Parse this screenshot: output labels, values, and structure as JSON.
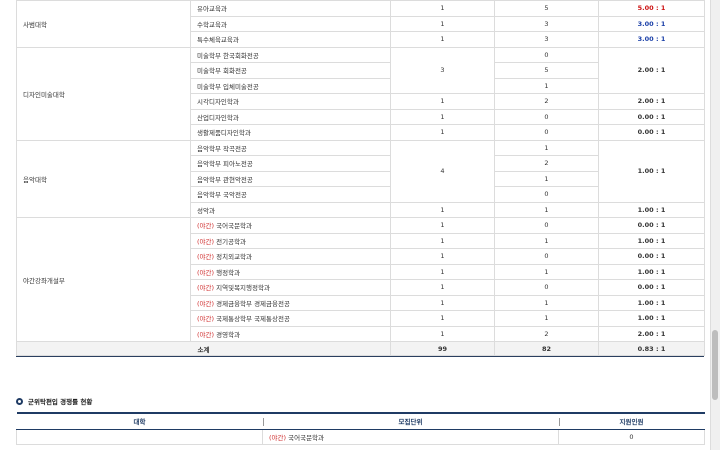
{
  "table1": {
    "groups": [
      {
        "college": "사범대학",
        "rows": [
          {
            "unit": "유아교육과",
            "quota": "1",
            "applicants": "5",
            "ratio": "5.00 : 1",
            "ratio_color": "red"
          },
          {
            "unit": "수학교육과",
            "quota": "1",
            "applicants": "3",
            "ratio": "3.00 : 1",
            "ratio_color": "blue"
          },
          {
            "unit": "특수체육교육과",
            "quota": "1",
            "applicants": "3",
            "ratio": "3.00 : 1",
            "ratio_color": "blue"
          }
        ]
      },
      {
        "college": "디자인미술대학",
        "rows": [
          {
            "unit": "미술학부 한국회화전공",
            "quota": "3",
            "applicants": "0",
            "ratio": "2.00 : 1",
            "merged_quota": 3
          },
          {
            "unit": "미술학부 회화전공",
            "applicants": "5"
          },
          {
            "unit": "미술학부 입체미술전공",
            "applicants": "1"
          },
          {
            "unit": "시각디자인학과",
            "quota": "1",
            "applicants": "2",
            "ratio": "2.00 : 1"
          },
          {
            "unit": "산업디자인학과",
            "quota": "1",
            "applicants": "0",
            "ratio": "0.00 : 1"
          },
          {
            "unit": "생활제품디자인학과",
            "quota": "1",
            "applicants": "0",
            "ratio": "0.00 : 1"
          }
        ]
      },
      {
        "college": "음악대학",
        "rows": [
          {
            "unit": "음악학부 작곡전공",
            "quota": "4",
            "applicants": "1",
            "ratio": "1.00 : 1",
            "merged_quota": 4
          },
          {
            "unit": "음악학부 피아노전공",
            "applicants": "2"
          },
          {
            "unit": "음악학부 관현악전공",
            "applicants": "1"
          },
          {
            "unit": "음악학부 국악전공",
            "applicants": "0"
          },
          {
            "unit": "성악과",
            "quota": "1",
            "applicants": "1",
            "ratio": "1.00 : 1"
          }
        ]
      },
      {
        "college": "야간강좌개설부",
        "rows": [
          {
            "prefix": "(야간)",
            "unit": "국어국문학과",
            "quota": "1",
            "applicants": "0",
            "ratio": "0.00 : 1"
          },
          {
            "prefix": "(야간)",
            "unit": "전기공학과",
            "quota": "1",
            "applicants": "1",
            "ratio": "1.00 : 1"
          },
          {
            "prefix": "(야간)",
            "unit": "정치외교학과",
            "quota": "1",
            "applicants": "0",
            "ratio": "0.00 : 1"
          },
          {
            "prefix": "(야간)",
            "unit": "행정학과",
            "quota": "1",
            "applicants": "1",
            "ratio": "1.00 : 1"
          },
          {
            "prefix": "(야간)",
            "unit": "지역및복지행정학과",
            "quota": "1",
            "applicants": "0",
            "ratio": "0.00 : 1"
          },
          {
            "prefix": "(야간)",
            "unit": "경제금융학부 경제금융전공",
            "quota": "1",
            "applicants": "1",
            "ratio": "1.00 : 1"
          },
          {
            "prefix": "(야간)",
            "unit": "국제통상학부 국제통상전공",
            "quota": "1",
            "applicants": "1",
            "ratio": "1.00 : 1"
          },
          {
            "prefix": "(야간)",
            "unit": "경영학과",
            "quota": "1",
            "applicants": "2",
            "ratio": "2.00 : 1"
          }
        ]
      }
    ],
    "total": {
      "label": "소계",
      "quota": "99",
      "applicants": "82",
      "ratio": "0.83 : 1"
    }
  },
  "section2": {
    "title": "군위탁편입 경쟁률 현황",
    "headers": {
      "college": "대학",
      "unit": "모집단위",
      "applicants": "지원인원"
    },
    "rows": [
      {
        "prefix": "(야간)",
        "unit": "국어국문학과",
        "applicants": "0"
      }
    ]
  },
  "colors": {
    "red": "#cc1111",
    "blue": "#1a3fa8",
    "navy": "#1f3b64",
    "night_prefix": "#d03030"
  }
}
